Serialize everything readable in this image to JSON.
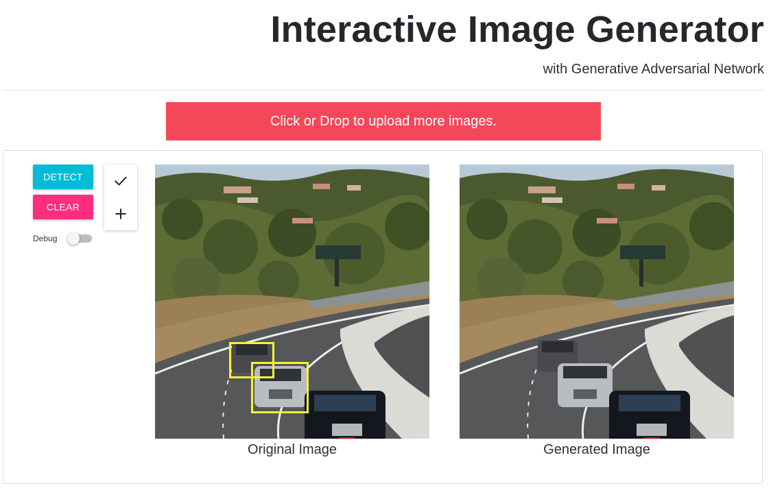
{
  "header": {
    "title": "Interactive Image Generator",
    "subtitle": "with Generative Adversarial Network"
  },
  "upload": {
    "label": "Click or Drop to upload more images."
  },
  "controls": {
    "detect_label": "DETECT",
    "clear_label": "CLEAR",
    "debug_label": "Debug",
    "debug_enabled": false
  },
  "tools": {
    "check_icon": "check-icon",
    "plus_icon": "plus-icon"
  },
  "images": {
    "original_caption": "Original Image",
    "generated_caption": "Generated Image",
    "detection_boxes": 2
  },
  "colors": {
    "upload_bg": "#f4485a",
    "detect_bg": "#00bcd4",
    "clear_bg": "#ff2d7e",
    "box_color": "#f6f23a"
  }
}
